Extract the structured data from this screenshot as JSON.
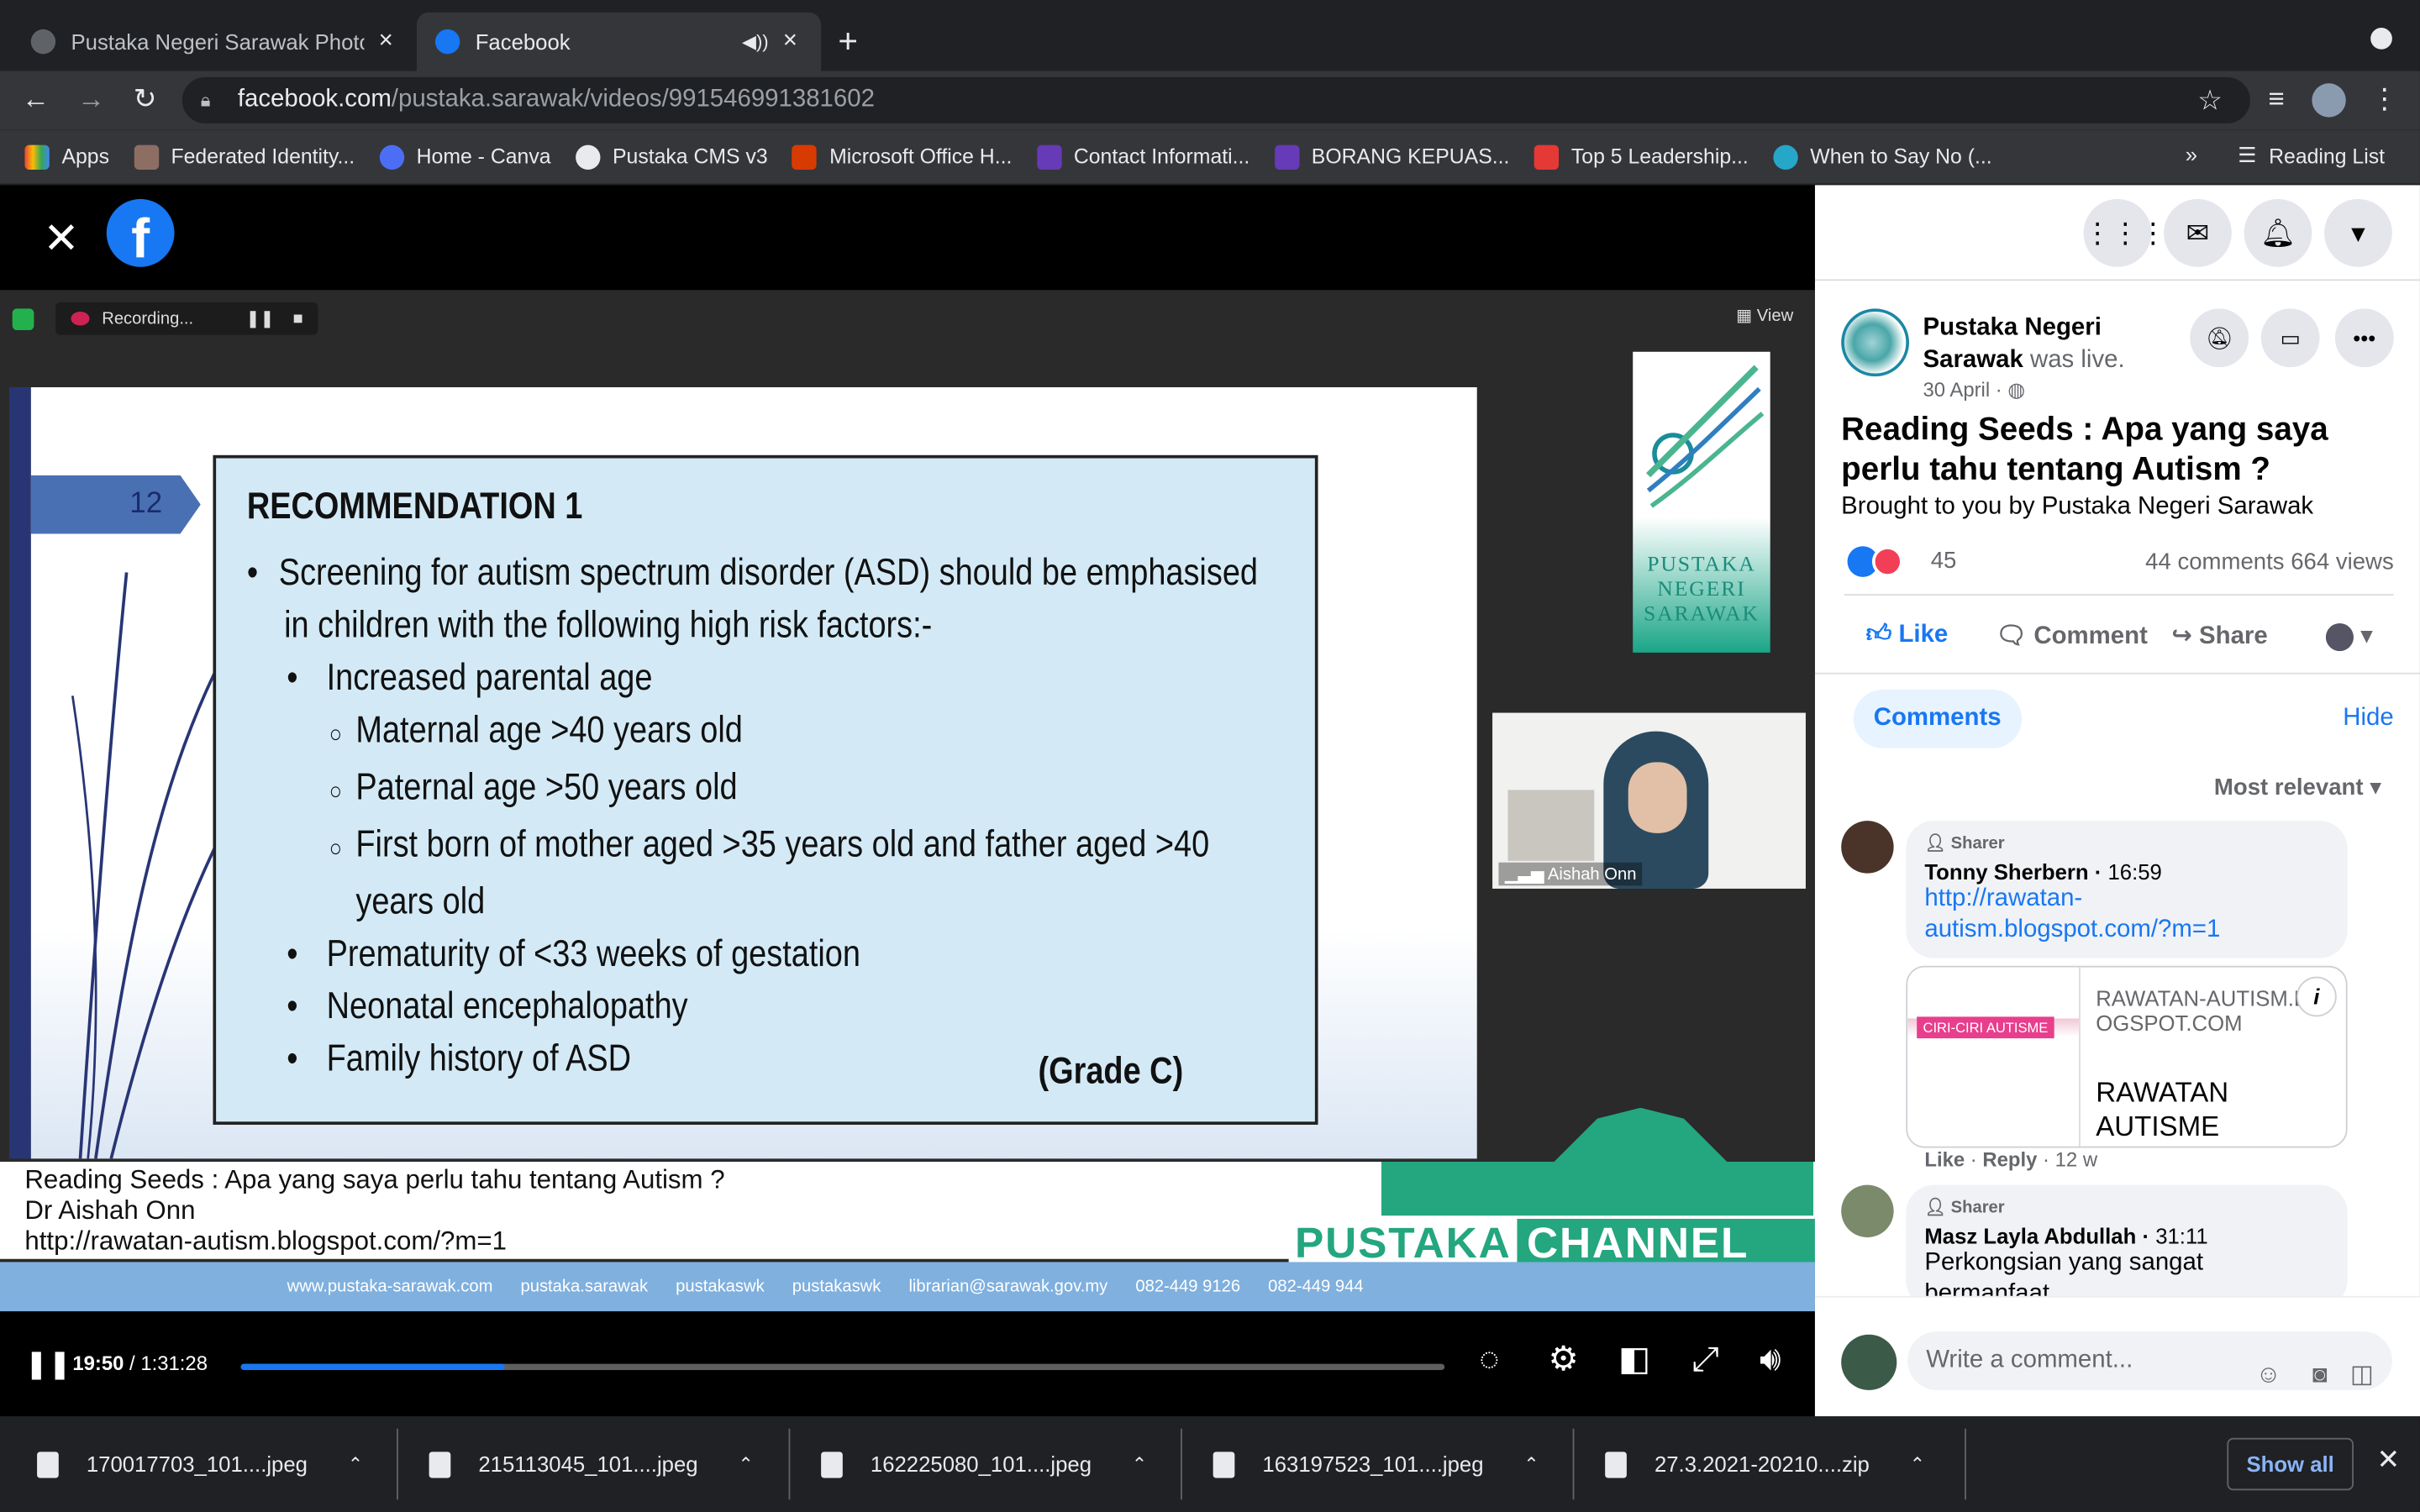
{
  "browser": {
    "tabs": [
      {
        "title": "Pustaka Negeri Sarawak Photo",
        "active": false
      },
      {
        "title": "Facebook",
        "active": true
      }
    ],
    "url_host": "facebook.com",
    "url_path": "/pustaka.sarawak/videos/991546991381602",
    "bookmarks": [
      "Apps",
      "Federated Identity...",
      "Home - Canva",
      "Pustaka CMS v3",
      "Microsoft Office H...",
      "Contact Informati...",
      "BORANG KEPUAS...",
      "Top 5 Leadership...",
      "When to Say No (..."
    ],
    "reading_list": "Reading List"
  },
  "video": {
    "zoom": {
      "recording": "Recording...",
      "view": "View"
    },
    "slide": {
      "number": "12",
      "heading": "RECOMMENDATION 1",
      "bullet1_line1": "Screening for autism spectrum disorder (ASD) should be emphasised",
      "bullet1_line2": "in children with the following high risk factors:-",
      "sub1": "Increased parental age",
      "sub1a": "Maternal age >40 years old",
      "sub1b": "Paternal age >50 years old",
      "sub1c_line1": "First born of mother aged >35 years old and father aged >40",
      "sub1c_line2": "years old",
      "sub2": "Prematurity of <33 weeks of gestation",
      "sub3": "Neonatal encephalopathy",
      "sub4": "Family history of ASD",
      "grade": "(Grade C)"
    },
    "logo_text": [
      "PUSTAKA",
      "NEGERI",
      "SARAWAK"
    ],
    "camera_name": "Aishah Onn",
    "lower_third": [
      "Reading Seeds : Apa yang saya perlu tahu tentang Autism ?",
      "Dr Aishah Onn",
      "http://rawatan-autism.blogspot.com/?m=1"
    ],
    "channel": {
      "part1": "PUSTAKA",
      "part2": "CHANNEL"
    },
    "footer": [
      "www.pustaka-sarawak.com",
      "pustaka.sarawak",
      "pustakaswk",
      "pustakaswk",
      "librarian@sarawak.gov.my",
      "082-449 9126",
      "082-449 944"
    ],
    "player": {
      "current": "19:50",
      "duration": "/ 1:31:28",
      "progress": 0.219
    }
  },
  "post": {
    "page_name": "Pustaka Negeri Sarawak",
    "was_live": "was live.",
    "date": "30 April ·",
    "title": "Reading Seeds : Apa yang saya perlu tahu tentang Autism ?",
    "description": "Brought to you by Pustaka Negeri Sarawak",
    "reaction_count": "45",
    "comments_count": "44 comments",
    "views": "664 views",
    "actions": {
      "like": "Like",
      "comment": "Comment",
      "share": "Share"
    },
    "tabs": {
      "comments": "Comments",
      "hide": "Hide"
    },
    "sort": "Most relevant"
  },
  "comments": [
    {
      "role": "Sharer",
      "name": "Tonny Sherbern",
      "time": "16:59",
      "link": "http://rawatan-autism.blogspot.com/?m=1",
      "preview": {
        "domain": "RAWATAN-AUTISM.BLOGSPOT.COM",
        "title": "RAWATAN AUTISME",
        "thumb_label": "CIRI-CIRI AUTISME"
      },
      "meta": {
        "like": "Like",
        "reply": "Reply",
        "age": "12 w"
      }
    },
    {
      "role": "Sharer",
      "name": "Masz Layla Abdullah",
      "time": "31:11",
      "text": "Perkongsian yang sangat bermanfaat"
    }
  ],
  "composer": {
    "placeholder": "Write a comment..."
  },
  "downloads": [
    "170017703_101....jpeg",
    "215113045_101....jpeg",
    "162225080_101....jpeg",
    "163197523_101....jpeg",
    "27.3.2021-20210....zip"
  ],
  "download_show_all": "Show all",
  "colors": {
    "facebook_blue": "#1877f2",
    "pustaka_green": "#24a67f",
    "slide_box": "#d3eaf6"
  }
}
